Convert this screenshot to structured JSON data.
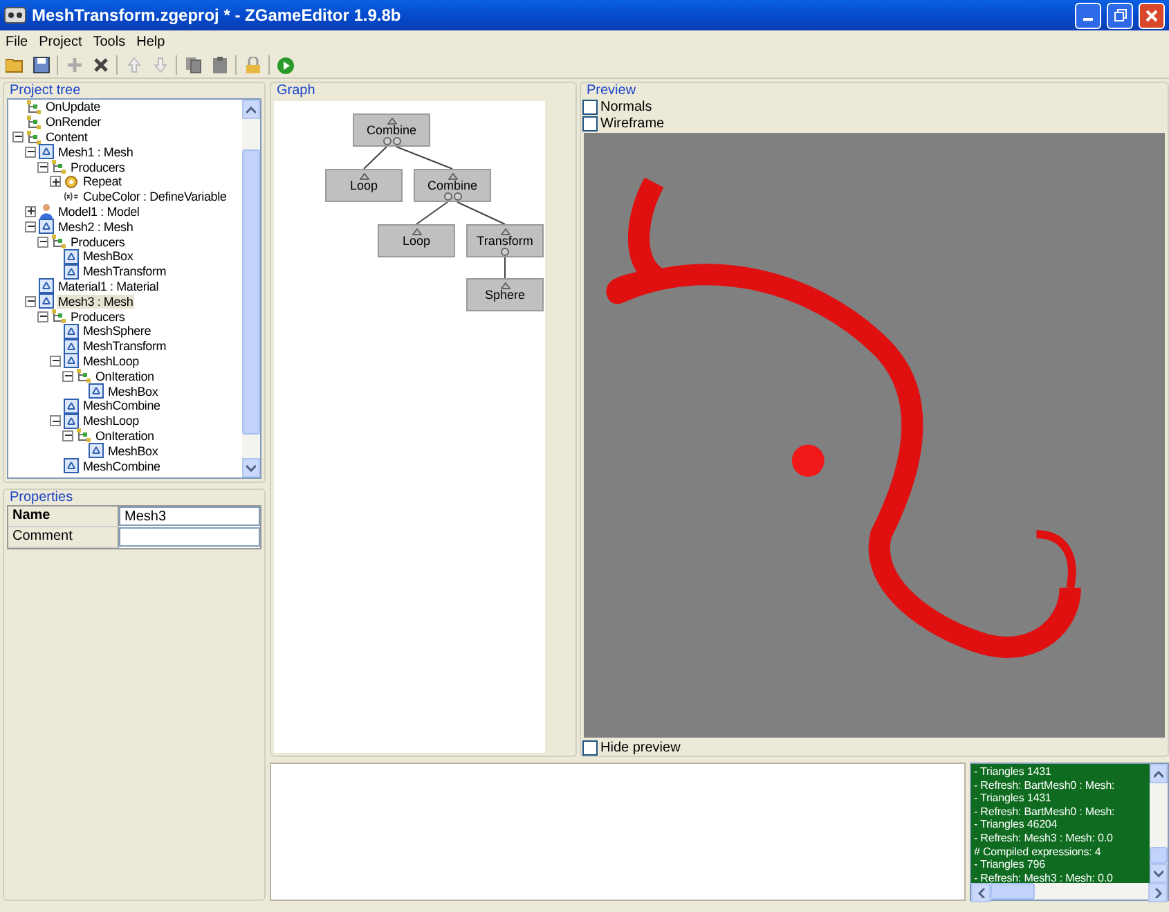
{
  "window": {
    "title": "MeshTransform.zgeproj * - ZGameEditor 1.9.8b"
  },
  "menu": [
    "File",
    "Project",
    "Tools",
    "Help"
  ],
  "project_tree": {
    "title": "Project tree",
    "items": [
      {
        "label": "OnUpdate",
        "kind": "event",
        "selected": false
      },
      {
        "label": "OnRender",
        "kind": "event",
        "selected": false
      },
      {
        "label": "Content",
        "kind": "event",
        "selected": false,
        "expanded": true,
        "children": [
          {
            "label": "Mesh1 : Mesh",
            "kind": "mesh",
            "selected": false,
            "expanded": true,
            "children": [
              {
                "label": "Producers",
                "kind": "event",
                "selected": false,
                "expanded": true,
                "children": [
                  {
                    "label": "Repeat",
                    "kind": "repeat",
                    "selected": false,
                    "expanded": false
                  },
                  {
                    "label": "CubeColor : DefineVariable",
                    "kind": "variable",
                    "selected": false
                  }
                ]
              }
            ]
          },
          {
            "label": "Model1 : Model",
            "kind": "model",
            "selected": false,
            "expanded": false
          },
          {
            "label": "Mesh2 : Mesh",
            "kind": "mesh",
            "selected": false,
            "expanded": true,
            "children": [
              {
                "label": "Producers",
                "kind": "event",
                "selected": false,
                "expanded": true,
                "children": [
                  {
                    "label": "MeshBox",
                    "kind": "mesh",
                    "selected": false
                  },
                  {
                    "label": "MeshTransform",
                    "kind": "mesh",
                    "selected": false
                  }
                ]
              }
            ]
          },
          {
            "label": "Material1 : Material",
            "kind": "mesh",
            "selected": false
          },
          {
            "label": "Mesh3 : Mesh",
            "kind": "mesh",
            "selected": true,
            "expanded": true,
            "children": [
              {
                "label": "Producers",
                "kind": "event",
                "selected": false,
                "expanded": true,
                "children": [
                  {
                    "label": "MeshSphere",
                    "kind": "mesh",
                    "selected": false
                  },
                  {
                    "label": "MeshTransform",
                    "kind": "mesh",
                    "selected": false
                  },
                  {
                    "label": "MeshLoop",
                    "kind": "mesh",
                    "selected": false,
                    "expanded": true,
                    "children": [
                      {
                        "label": "OnIteration",
                        "kind": "event",
                        "selected": false,
                        "expanded": true,
                        "children": [
                          {
                            "label": "MeshBox",
                            "kind": "mesh",
                            "selected": false
                          }
                        ]
                      }
                    ]
                  },
                  {
                    "label": "MeshCombine",
                    "kind": "mesh",
                    "selected": false
                  },
                  {
                    "label": "MeshLoop",
                    "kind": "mesh",
                    "selected": false,
                    "expanded": true,
                    "children": [
                      {
                        "label": "OnIteration",
                        "kind": "event",
                        "selected": false,
                        "expanded": true,
                        "children": [
                          {
                            "label": "MeshBox",
                            "kind": "mesh",
                            "selected": false
                          }
                        ]
                      }
                    ]
                  },
                  {
                    "label": "MeshCombine",
                    "kind": "mesh",
                    "selected": false
                  }
                ]
              }
            ]
          }
        ]
      }
    ]
  },
  "properties": {
    "title": "Properties",
    "rows": [
      {
        "name": "Name",
        "value": "Mesh3"
      },
      {
        "name": "Comment"
      }
    ]
  },
  "graph": {
    "title": "Graph",
    "root": {
      "label": "Combine",
      "children": [
        {
          "label": "Loop"
        },
        {
          "label": "Combine",
          "children": [
            {
              "label": "Loop"
            },
            {
              "label": "Transform",
              "children": [
                {
                  "label": "Sphere"
                }
              ]
            }
          ]
        }
      ]
    }
  },
  "preview": {
    "title": "Preview",
    "options": [
      {
        "label": "Normals",
        "checked": false
      },
      {
        "label": "Wireframe",
        "checked": false
      }
    ],
    "hide_preview": {
      "label": "Hide preview",
      "checked": false
    }
  },
  "log": [
    "- Triangles 1431",
    "- Refresh: BartMesh0 : Mesh:",
    "- Triangles 1431",
    "- Refresh: BartMesh0 : Mesh:",
    "- Triangles 46204",
    "- Refresh: Mesh3 : Mesh: 0.0",
    "# Compiled expressions: 4",
    "- Triangles 796",
    "- Refresh: Mesh3 : Mesh: 0.0"
  ]
}
